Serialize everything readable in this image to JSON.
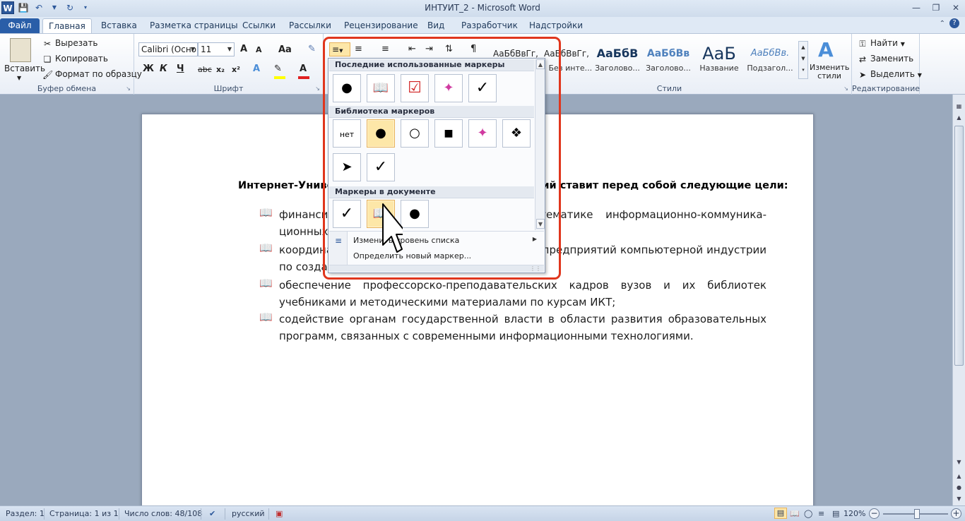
{
  "window": {
    "title": "ИНТУИТ_2 - Microsoft Word",
    "logo": "W"
  },
  "tabs": [
    "Файл",
    "Главная",
    "Вставка",
    "Разметка страницы",
    "Ссылки",
    "Рассылки",
    "Рецензирование",
    "Вид",
    "Разработчик",
    "Надстройки"
  ],
  "ribbon": {
    "clipboard": {
      "paste": "Вставить",
      "cut": "Вырезать",
      "copy": "Копировать",
      "format_painter": "Формат по образцу",
      "label": "Буфер обмена"
    },
    "font": {
      "name": "Calibri (Осно",
      "size": "11",
      "grow": "A",
      "shrink": "A",
      "case": "Aa",
      "bold": "Ж",
      "italic": "К",
      "underline": "Ч",
      "strike": "abc",
      "subscript": "x₂",
      "superscript": "x²",
      "label": "Шрифт"
    },
    "styles": {
      "items": [
        {
          "sample": "АаБбВвГг,",
          "name": ""
        },
        {
          "sample": "АаБбВвГг,",
          "name": "1 Без инте..."
        },
        {
          "sample": "АаБбВ",
          "name": "Заголово..."
        },
        {
          "sample": "АаБбВв",
          "name": "Заголово..."
        },
        {
          "sample": "АаБ",
          "name": "Название"
        },
        {
          "sample": "АаБбВв.",
          "name": "Подзагол..."
        }
      ],
      "change_styles": "Изменить стили",
      "label": "Стили"
    },
    "editing": {
      "find": "Найти",
      "replace": "Заменить",
      "select": "Выделить",
      "label": "Редактирование"
    }
  },
  "document": {
    "heading": "Интернет-Университет Информационных Технологий ставит перед собой следующие цели:",
    "bullets": [
      "финансирование разработки курсов по тематике информационно-коммуника-ционных технологий;",
      "координация усилий вузов, научных центров, предприятий компьютерной индустрии по созданию учебных курсов;",
      "обеспечение профессорско-преподавательских кадров вузов и их библиотек учебниками и методическими материалами по курсам ИКТ;",
      "содействие органам государственной власти в области развития образовательных программ, связанных с современными информационными технологиями."
    ]
  },
  "gallery": {
    "recent_title": "Последние использованные маркеры",
    "library_title": "Библиотека маркеров",
    "document_title": "Маркеры в документе",
    "none_label": "нет",
    "change_level": "Изменить уровень списка",
    "define_new": "Определить новый маркер..."
  },
  "status": {
    "section": "Раздел: 1",
    "page": "Страница: 1 из 1",
    "words": "Число слов: 48/108",
    "language": "русский",
    "zoom": "120%"
  },
  "colors": {
    "accent": "#2b579a",
    "highlight": "#e0361d"
  }
}
